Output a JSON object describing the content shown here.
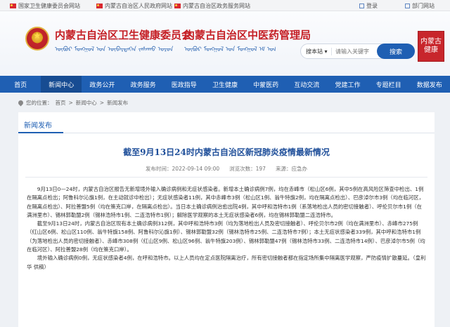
{
  "topbar": {
    "links": [
      "国家卫生健康委员会网站",
      "内蒙古自治区人民政府网站",
      "内蒙古自治区政务服务网站"
    ],
    "right_links": [
      "登录",
      "部门网站"
    ]
  },
  "header": {
    "title_health": "内蒙古自治区卫生健康委员会",
    "title_tcm": "内蒙古自治区中医药管理局",
    "mongol_health": "ᠦᠪᠦᠷ ᠮᠣᠩᠭᠣᠯ ᠤᠨ ᠥᠪᠡᠷᠲᠡᠭᠡᠨ ᠵᠠᠰᠠᠬᠤ ᠣᠷᠣᠨ ᠤ ᠡᠷᠡᠭᠦᠯ",
    "mongol_tcm": "ᠦᠪᠦᠷ ᠮᠣᠩᠭᠣᠯ ᠤᠨ ᠮᠣᠩᠭᠣᠯ ᠡᠮ ᠤᠨ ᠭᠠᠵᠠᠷ",
    "search_scope": "搜本站 ▾",
    "search_placeholder": "请输入关键字",
    "search_button": "搜索",
    "seal_text": "内蒙古健康"
  },
  "nav": {
    "items": [
      "首页",
      "新闻中心",
      "政务公开",
      "政务服务",
      "医政指导",
      "卫生健康",
      "中蒙医药",
      "互动交流",
      "党建工作",
      "专题栏目",
      "数据发布"
    ]
  },
  "breadcrumb": {
    "label": "您的位置：",
    "items": [
      "首页",
      "新闻中心",
      "新闻发布"
    ]
  },
  "section": {
    "tab": "新闻发布"
  },
  "article": {
    "title": "截至9月13日24时内蒙古自治区新冠肺炎疫情最新情况",
    "date": "发布时间：2022-09-14 09:00",
    "views": "浏览次数：197",
    "source": "来源：应急办",
    "paragraphs": [
      "9月13日0—24时，内蒙古自治区报告无新增境外输入确诊病例和无症状感染者。新增本土确诊病例7例，均在赤峰市（松山区6例，其中5例在高风险区筛查中检出、1例在隔离点检出；阿鲁科尔沁旗1例，在主动就诊中检出）；无症状感染者11例，其中赤峰市3例（松山区1例、翁牛特旗2例，均在隔离点检出）、巴彦淖尔市3例（均在临河区，在隔离点检出）、阿拉善盟5例（均在策克口岸，在隔离点检出）。当日本土确诊病例治愈出院4例，其中呼和浩特市1例（系落地检出人员的密切接触者）、呼伦贝尔市1例（在满洲里市）、锡林郭勒盟2例（锡林浩特市1例、二连浩特市1例）；解除医学观察的本土无症状感染者6例，均在锡林郭勒盟二连浩特市。",
      "截至9月13日24时，内蒙古自治区现有本土确诊病例312例，其中呼和浩特市3例（均为落地检出人员及密切接触者）、呼伦贝尔市2例（均在满洲里市）、赤峰市275例（红山区6例、松山区110例、翁牛特旗158例、阿鲁科尔沁旗1例）、锡林郭勒盟32例（锡林浩特市25例、二连浩特市7例）；本土无症状感染者339例，其中呼和浩特市1例（为落地检出人员的密切接触者）、赤峰市308例（红山区9例、松山区96例、翁牛特旗203例）、锡林郭勒盟47例（锡林浩特市33例、二连浩特市14例）、巴彦淖尔市5例（均在临河区）、阿拉善盟28例（均在策克口岸）。",
      "境外输入确诊病例0例，无症状感染者4例，在呼和浩特市。以上人员均在定点医院隔离治疗，所有密切接触者都在指定场所集中隔离医学观察，严防疫情扩散蔓延。（皇利华 供稿）"
    ]
  },
  "colors": {
    "brand_blue": "#1f5fb3",
    "title_red": "#c51f25"
  }
}
